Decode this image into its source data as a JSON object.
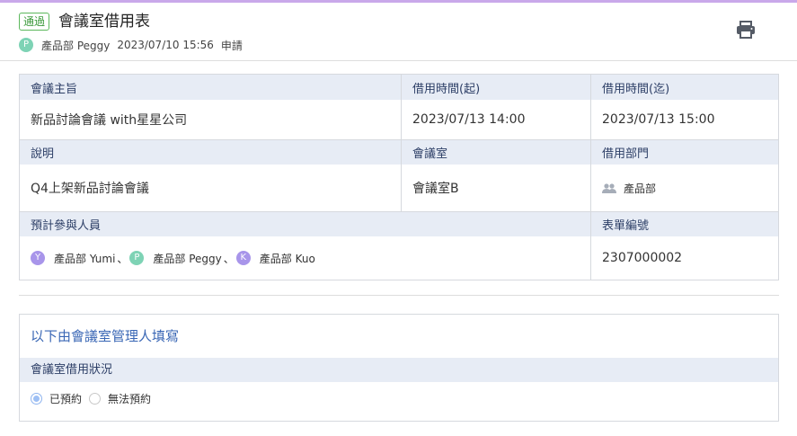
{
  "header": {
    "status_badge": "通過",
    "title": "會議室借用表",
    "applicant_avatar": "P",
    "applicant_name": "產品部 Peggy",
    "applied_at": "2023/07/10 15:56",
    "action_text": "申請",
    "print_icon": "printer-icon"
  },
  "fields": {
    "topic_label": "會議主旨",
    "topic_value": "新品討論會議 with星星公司",
    "start_label": "借用時間(起)",
    "start_value": "2023/07/13 14:00",
    "end_label": "借用時間(迄)",
    "end_value": "2023/07/13 15:00",
    "desc_label": "說明",
    "desc_value": "Q4上架新品討論會議",
    "room_label": "會議室",
    "room_value": "會議室B",
    "dept_label": "借用部門",
    "dept_value": "產品部",
    "attendees_label": "預計參與人員",
    "attendees": [
      {
        "initial": "Y",
        "name": "產品部 Yumi",
        "color": "#a895ea"
      },
      {
        "initial": "P",
        "name": "產品部 Peggy",
        "color": "#7ed3b5"
      },
      {
        "initial": "K",
        "name": "產品部 Kuo",
        "color": "#a895ea"
      }
    ],
    "attendee_separator": "、",
    "form_no_label": "表單編號",
    "form_no_value": "2307000002"
  },
  "admin": {
    "section_title": "以下由會議室管理人填寫",
    "status_label": "會議室借用狀況",
    "options": [
      {
        "label": "已預約",
        "checked": true
      },
      {
        "label": "無法預約",
        "checked": false
      }
    ]
  },
  "colors": {
    "accent_top": "#c9a8ea",
    "badge_green": "#5cb85c",
    "label_bg": "#e7ecf5",
    "section_title": "#3a67b5",
    "applicant_avatar": "#7ed3b5"
  }
}
